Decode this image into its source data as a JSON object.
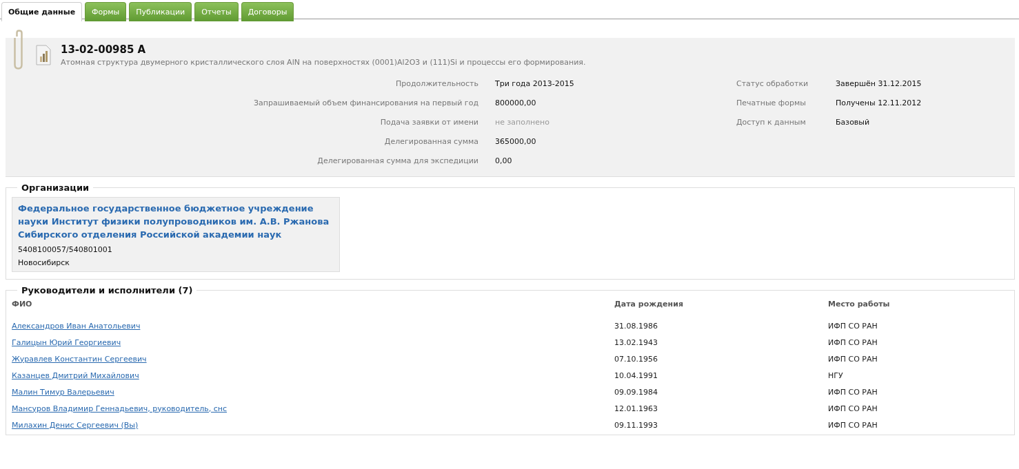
{
  "tabs": [
    {
      "label": "Общие данные",
      "selected": true
    },
    {
      "label": "Формы",
      "selected": false
    },
    {
      "label": "Публикации",
      "selected": false
    },
    {
      "label": "Отчеты",
      "selected": false
    },
    {
      "label": "Договоры",
      "selected": false
    }
  ],
  "project": {
    "number": "13-02-00985 А",
    "title": "Атомная структура двумерного кристаллического слоя AlN на поверхностях (0001)Al2O3 и (111)Si и процессы его формирования.",
    "fields_left": [
      {
        "label": "Продолжительность",
        "value": "Три года 2013-2015",
        "empty": false
      },
      {
        "label": "Запрашиваемый объем финансирования на первый год",
        "value": "800000,00",
        "empty": false
      },
      {
        "label": "Подача заявки от имени",
        "value": "не заполнено",
        "empty": true
      },
      {
        "label": "Делегированная сумма",
        "value": "365000,00",
        "empty": false
      },
      {
        "label": "Делегированная сумма для экспедиции",
        "value": "0,00",
        "empty": false
      }
    ],
    "fields_right": [
      {
        "label": "Статус обработки",
        "value": "Завершён 31.12.2015",
        "empty": false
      },
      {
        "label": "Печатные формы",
        "value": "Получены 12.11.2012",
        "empty": false
      },
      {
        "label": "Доступ к данным",
        "value": "Базовый",
        "empty": false
      }
    ]
  },
  "organizations": {
    "title": "Организации",
    "items": [
      {
        "name": "Федеральное государственное бюджетное учреждение науки Институт физики полупроводников им. А.В. Ржанова Сибирского отделения Российской академии наук",
        "codes": "5408100057/540801001",
        "city": "Новосибирск"
      }
    ]
  },
  "people": {
    "title": "Руководители и исполнители (7)",
    "columns": [
      "ФИО",
      "Дата рождения",
      "Место работы"
    ],
    "rows": [
      [
        "Александров Иван Анатольевич",
        "31.08.1986",
        "ИФП СО РАН"
      ],
      [
        "Галицын Юрий Георгиевич",
        "13.02.1943",
        "ИФП СО РАН"
      ],
      [
        "Журавлев Константин Сергеевич",
        "07.10.1956",
        "ИФП СО РАН"
      ],
      [
        "Казанцев Дмитрий Михайлович",
        "10.04.1991",
        "НГУ"
      ],
      [
        "Малин Тимур Валерьевич",
        "09.09.1984",
        "ИФП СО РАН"
      ],
      [
        "Мансуров Владимир Геннадьевич, руководитель, снс",
        "12.01.1963",
        "ИФП СО РАН"
      ],
      [
        "Милахин Денис Сергеевич (Вы)",
        "09.11.1993",
        "ИФП СО РАН"
      ]
    ]
  }
}
